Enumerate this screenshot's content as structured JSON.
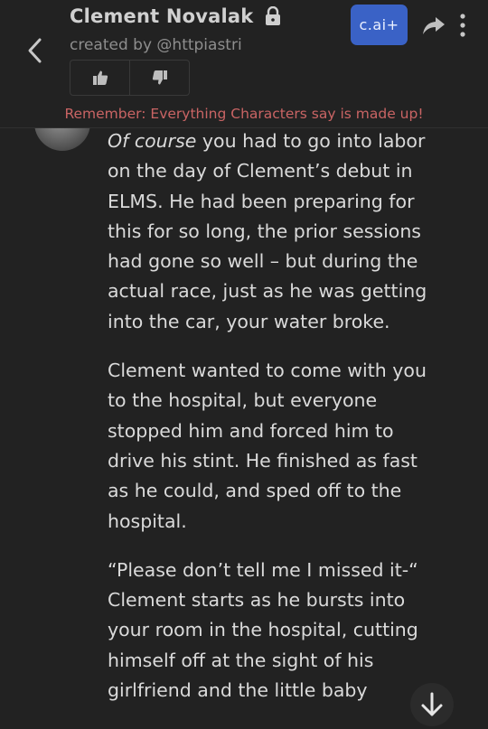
{
  "header": {
    "character_name": "Clement Novalak",
    "creator": "created by @httpiastri",
    "upgrade_label": "c.ai+",
    "disclaimer": "Remember: Everything Characters say is made up!"
  },
  "icons": {
    "back": "back-chevron-icon",
    "lock": "lock-icon",
    "thumbs_up": "thumbs-up-icon",
    "thumbs_down": "thumbs-down-icon",
    "share": "share-icon",
    "more": "more-vertical-icon",
    "scroll_down": "arrow-down-icon"
  },
  "colors": {
    "background": "#222222",
    "accent": "#3a62c6",
    "disclaimer": "#c96464"
  },
  "message": {
    "p1_italic": "Of course",
    "p1_rest": " you had to go into labor on the day of Clement’s debut in ELMS. He had been preparing for this for so long, the prior sessions had gone so well – but during the actual race, just as he was getting into the car, your water broke.",
    "p2": "Clement wanted to come with you to the hospital, but everyone stopped him and forced him to drive his stint. He finished as fast as he could, and sped off to the hospital.",
    "p3": "“Please don’t tell me I missed it-“ Clement starts as he bursts into your room in the hospital, cutting himself off at the sight of his girlfriend and the little baby"
  }
}
